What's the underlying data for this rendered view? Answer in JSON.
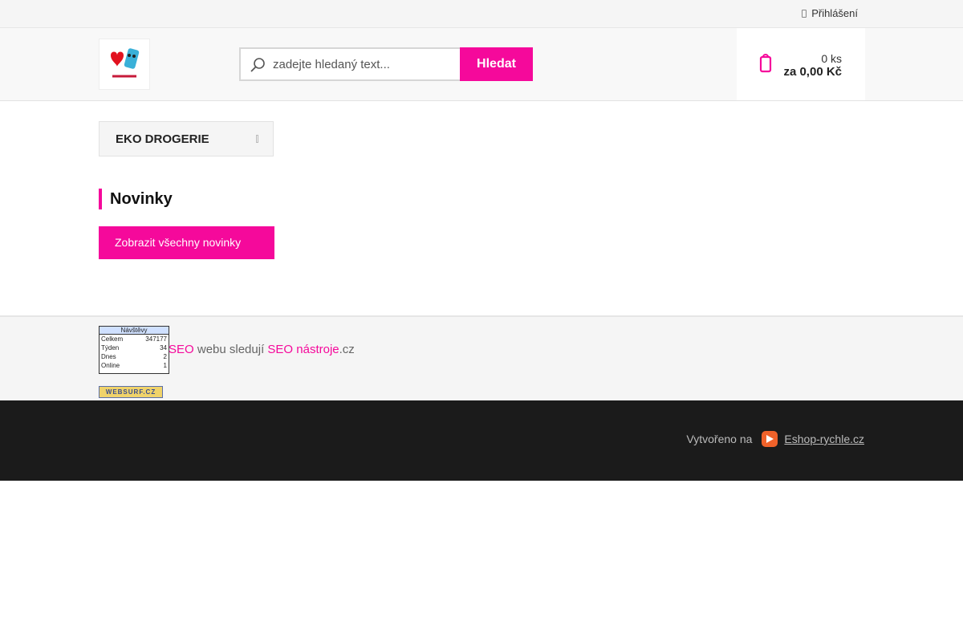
{
  "topbar": {
    "login_label": "Přihlášení"
  },
  "header": {
    "logo_alt": "Dedra Shop",
    "search": {
      "placeholder": "zadejte hledaný text...",
      "button_label": "Hledat"
    },
    "cart": {
      "quantity": "0 ks",
      "total": "za 0,00 Kč"
    }
  },
  "sidebar": {
    "category_label": "EKO DROGERIE"
  },
  "novinky": {
    "title": "Novinky",
    "show_all_label": "Zobrazit všechny novinky"
  },
  "counters": {
    "toplist": {
      "header": "Návštěvy",
      "rows": [
        {
          "label": "Celkem",
          "value": "347177"
        },
        {
          "label": "Týden",
          "value": "34"
        },
        {
          "label": "Dnes",
          "value": "2"
        },
        {
          "label": "Online",
          "value": "1"
        }
      ]
    },
    "seo_text": {
      "part1": "SEO",
      "part2": " webu sledují ",
      "part3": "SEO nástroje",
      "part4": ".cz"
    },
    "websurf_label": "WEBSURF.CZ"
  },
  "footer": {
    "created_label": "Vytvořeno na",
    "eshop_link": "Eshop-rychle.cz"
  },
  "colors": {
    "accent": "#f5099b",
    "footer_bg": "#1b1b1b"
  }
}
